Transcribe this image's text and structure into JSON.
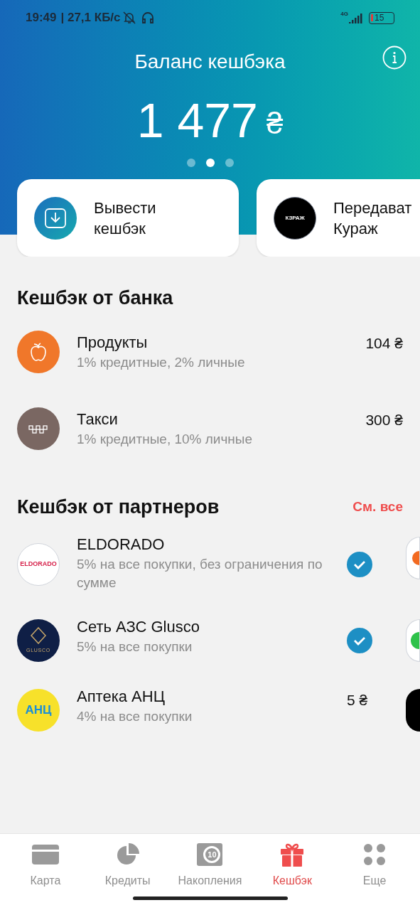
{
  "status_bar": {
    "time": "19:49",
    "speed": "| 27,1 КБ/с",
    "network": "4G",
    "battery": "15"
  },
  "header": {
    "title": "Баланс кешбэка",
    "balance": "1 477",
    "currency": "₴",
    "pager": [
      {
        "selected": false
      },
      {
        "selected": true
      },
      {
        "selected": false
      }
    ]
  },
  "actions": [
    {
      "kind": "withdraw",
      "lines": [
        "Вывести",
        "кешбэк"
      ]
    },
    {
      "kind": "kurazh",
      "logo_text": "КЗРАЖ",
      "lines": [
        "Передават",
        "Кураж"
      ]
    }
  ],
  "bank_cashback": {
    "title": "Кешбэк от банка",
    "items": [
      {
        "kind": "groceries",
        "name": "Продукты",
        "description": "1% кредитные, 2% личные",
        "amount": "104 ₴"
      },
      {
        "kind": "taxi",
        "name": "Такси",
        "description": "1% кредитные, 10% личные",
        "amount": "300 ₴"
      }
    ]
  },
  "partner_cashback": {
    "title": "Кешбэк от партнеров",
    "link": "См. все",
    "items": [
      {
        "kind": "eldorado",
        "logo_text": "ELDORADO",
        "name": "ELDORADO",
        "description": "5% на все покупки, без ограничения по сумме",
        "activated": true
      },
      {
        "kind": "glusco",
        "logo_text": "GLUSCO",
        "name": "Сеть АЗС Glusco",
        "description": "5% на все покупки",
        "activated": true
      },
      {
        "kind": "anc",
        "logo_text": "АНЦ",
        "name": "Аптека АНЦ",
        "description": "4% на все покупки",
        "activated": false,
        "amount": "5 ₴"
      }
    ]
  },
  "bottom_nav": [
    {
      "kind": "card",
      "label": "Карта",
      "selected": false
    },
    {
      "kind": "credit",
      "label": "Кредиты",
      "selected": false
    },
    {
      "kind": "savings",
      "label": "Накопления",
      "badge": "10",
      "selected": false
    },
    {
      "kind": "cashback",
      "label": "Кешбэк",
      "selected": true
    },
    {
      "kind": "more",
      "label": "Еще",
      "selected": false
    }
  ]
}
